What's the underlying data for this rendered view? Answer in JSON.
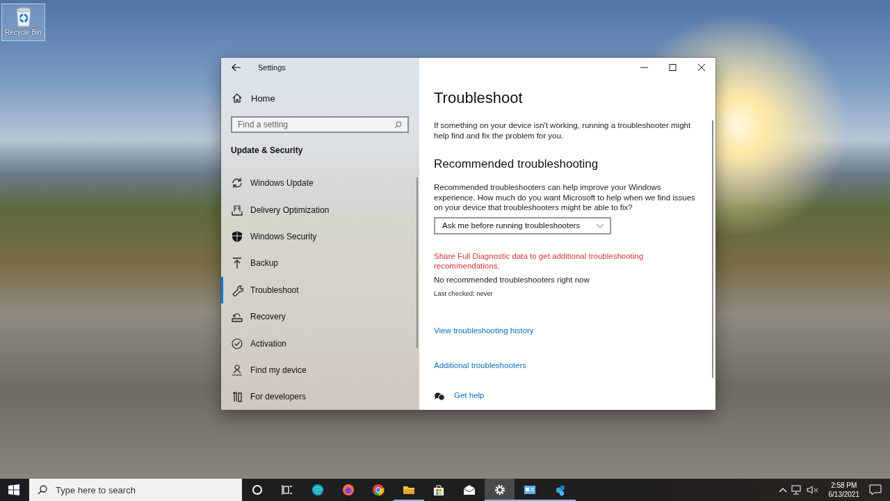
{
  "desktop_icons": [
    {
      "label": "Recycle Bin",
      "selected": true
    }
  ],
  "settings_window": {
    "title": "Settings",
    "home": "Home",
    "search": {
      "placeholder": "Find a setting"
    },
    "section": "Update & Security",
    "nav": [
      {
        "label": "Windows Update",
        "selected": false
      },
      {
        "label": "Delivery Optimization",
        "selected": false
      },
      {
        "label": "Windows Security",
        "selected": false
      },
      {
        "label": "Backup",
        "selected": false
      },
      {
        "label": "Troubleshoot",
        "selected": true
      },
      {
        "label": "Recovery",
        "selected": false
      },
      {
        "label": "Activation",
        "selected": false
      },
      {
        "label": "Find my device",
        "selected": false
      },
      {
        "label": "For developers",
        "selected": false
      }
    ],
    "content": {
      "title": "Troubleshoot",
      "intro": "If something on your device isn't working, running a troubleshooter might help find and fix the problem for you.",
      "heading": "Recommended troubleshooting",
      "description": "Recommended troubleshooters can help improve your Windows experience. How much do you want Microsoft to help when we find issues on your device that troubleshooters might be able to fix?",
      "dropdown": {
        "value": "Ask me before running troubleshooters"
      },
      "warning": "Share Full Diagnostic data to get additional troubleshooting recommendations.",
      "status": "No recommended troubleshooters right now",
      "last_checked": "Last checked: never",
      "links": [
        "View troubleshooting history",
        "Additional troubleshooters"
      ],
      "help": "Get help"
    }
  },
  "taskbar": {
    "search": {
      "placeholder": "Type here to search"
    },
    "apps": [
      {
        "running": false,
        "active": false
      },
      {
        "running": false,
        "active": false
      },
      {
        "running": false,
        "active": false
      },
      {
        "running": false,
        "active": false
      },
      {
        "running": false,
        "active": false
      },
      {
        "running": true,
        "active": false
      },
      {
        "running": false,
        "active": false
      },
      {
        "running": false,
        "active": false
      },
      {
        "running": true,
        "active": true
      },
      {
        "running": true,
        "active": false
      },
      {
        "running": true,
        "active": false
      }
    ],
    "clock": {
      "time": "2:58 PM",
      "date": "6/13/2021"
    }
  }
}
